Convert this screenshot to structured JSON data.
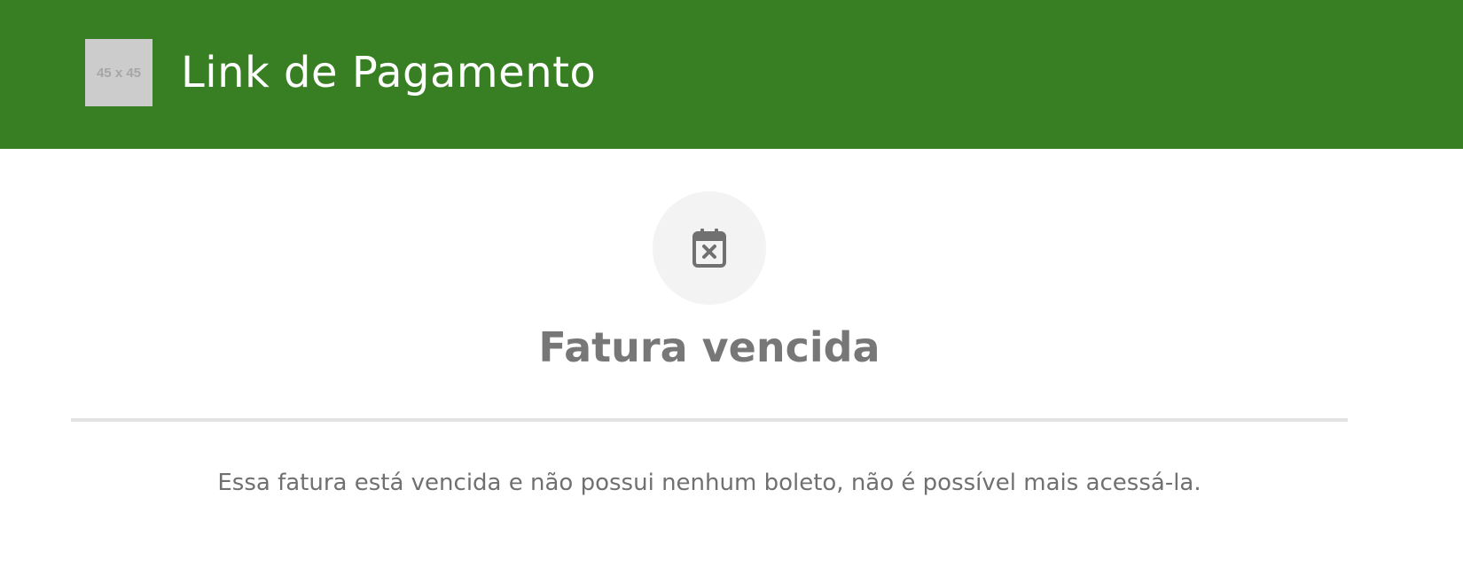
{
  "header": {
    "logo_placeholder": "45 x 45",
    "title": "Link de Pagamento",
    "background_color": "#387f23"
  },
  "status": {
    "icon": "calendar-x-icon",
    "title": "Fatura vencida",
    "message": "Essa fatura está vencida e não possui nenhum boleto, não é possível mais acessá-la."
  },
  "colors": {
    "header": "#387f23",
    "icon_circle": "#f3f3f3",
    "text_muted": "#777777"
  }
}
